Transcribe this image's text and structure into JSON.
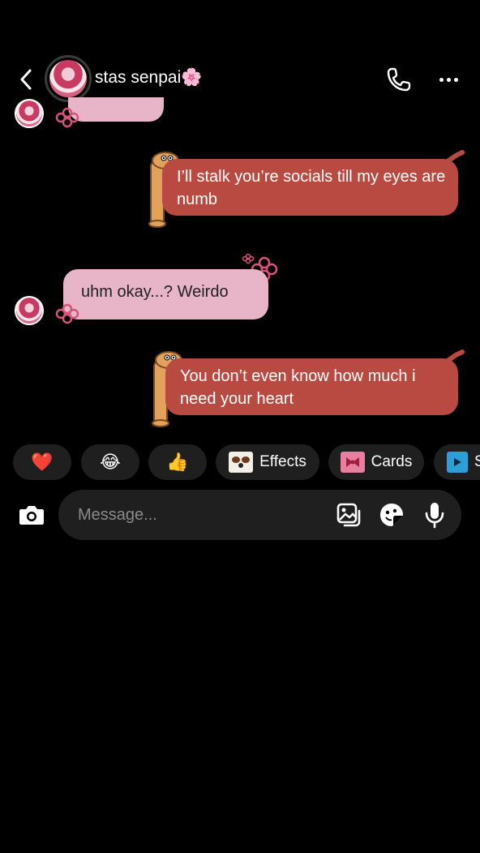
{
  "header": {
    "title": "stas senpai🌸",
    "back_icon": "chevron-left-icon",
    "call_icon": "phone-icon",
    "more_icon": "more-horizontal-icon"
  },
  "messages": [
    {
      "direction": "sent",
      "text": "I’ll stalk you’re socials till my eyes are numb"
    },
    {
      "direction": "received",
      "text": "uhm okay...? Weirdo"
    },
    {
      "direction": "sent",
      "text": "You don’t even know how much i need your heart"
    }
  ],
  "quick_actions": [
    {
      "icon": "heart-emoji",
      "glyph": "❤️"
    },
    {
      "icon": "laughing-emoji",
      "glyph": "😂"
    },
    {
      "icon": "thumbs-up-emoji",
      "glyph": "👍"
    },
    {
      "icon": "effects-icon",
      "label": "Effects"
    },
    {
      "icon": "cards-icon",
      "label": "Cards"
    },
    {
      "icon": "s-app-icon",
      "label": "S"
    }
  ],
  "composer": {
    "placeholder": "Message...",
    "camera_icon": "camera-icon",
    "gallery_icon": "gallery-icon",
    "sticker_icon": "sticker-icon",
    "mic_icon": "microphone-icon"
  },
  "colors": {
    "background": "#000000",
    "sent_bubble": "#b94a42",
    "received_bubble": "#e8b4c8",
    "chip_background": "#1f1f1f",
    "composer_background": "#1f1f1f"
  }
}
